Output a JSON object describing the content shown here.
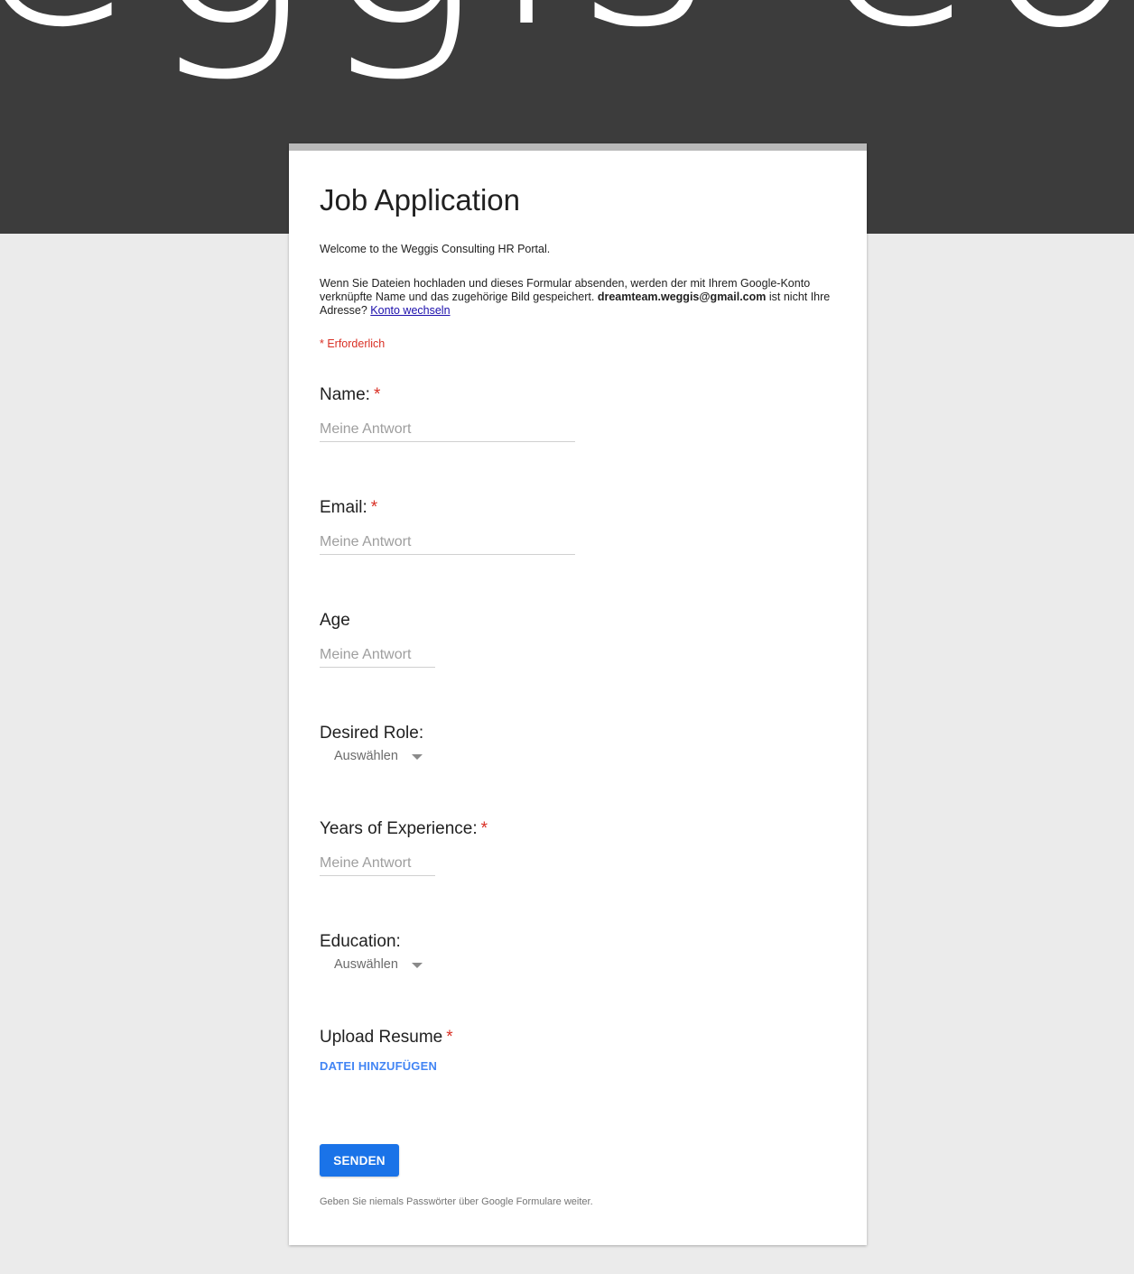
{
  "banner": {
    "text": "eggis consu"
  },
  "form": {
    "title": "Job Application",
    "welcome": "Welcome to the Weggis Consulting HR Portal.",
    "notice_before": "Wenn Sie Dateien hochladen und dieses Formular absenden, werden der mit Ihrem Google-Konto verknüpfte Name und das zugehörige Bild gespeichert. ",
    "account_email": "dreamteam.weggis@gmail.com",
    "notice_after": " ist nicht Ihre Adresse? ",
    "switch_account_link": "Konto wechseln",
    "required_note": "* Erforderlich"
  },
  "questions": {
    "name": {
      "label": "Name:",
      "required_mark": "*",
      "placeholder": "Meine Antwort"
    },
    "email": {
      "label": "Email:",
      "required_mark": "*",
      "placeholder": "Meine Antwort"
    },
    "age": {
      "label": "Age",
      "placeholder": "Meine Antwort"
    },
    "desired_role": {
      "label": "Desired Role:",
      "select_value": "Auswählen"
    },
    "experience": {
      "label": "Years of Experience:",
      "required_mark": "*",
      "placeholder": "Meine Antwort"
    },
    "education": {
      "label": "Education:",
      "select_value": "Auswählen"
    },
    "resume": {
      "label": "Upload Resume",
      "required_mark": "*",
      "add_file_label": "DATEI HINZUFÜGEN"
    }
  },
  "submit": {
    "label": "SENDEN"
  },
  "footer": {
    "note": "Geben Sie niemals Passwörter über Google Formulare weiter."
  },
  "colors": {
    "banner_bg": "#3c3c3c",
    "page_bg": "#ebebeb",
    "required": "#d93025",
    "accent": "#1a73e8",
    "link_blue": "#4285f4"
  },
  "icons": {
    "select_caret": "caret-down-icon"
  }
}
